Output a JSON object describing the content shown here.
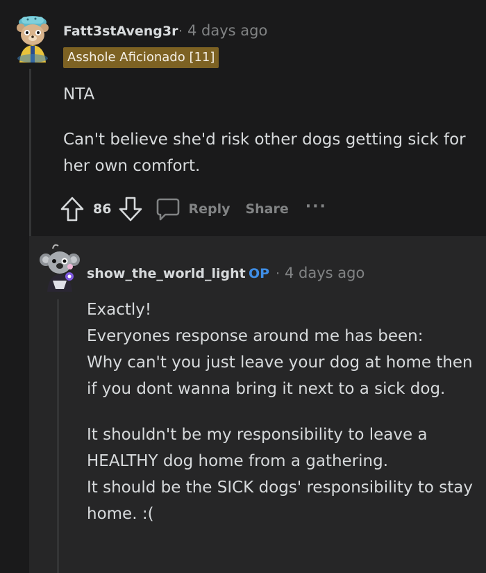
{
  "comment": {
    "username": "Fatt3stAveng3r",
    "separator": "·",
    "timestamp": "4 days ago",
    "flair": "Asshole Aficionado [11]",
    "body": [
      "NTA",
      "Can't believe she'd risk other dogs getting sick for her own comfort."
    ],
    "vote_count": "86",
    "reply_label": "Reply",
    "share_label": "Share",
    "more_label": "···",
    "icons": [
      "upvote-icon",
      "downvote-icon",
      "reply-icon",
      "more-icon"
    ]
  },
  "reply": {
    "username": "show_the_world_light",
    "op_badge": "OP",
    "separator": "·",
    "timestamp": "4 days ago",
    "body": {
      "line1": "Exactly!",
      "line2": "Everyones response around me has been:",
      "line3": "Why can't you just leave your dog at home then if you dont wanna bring it next to a sick dog.",
      "line4": "It shouldn't be my responsibility to leave a HEALTHY dog home from a gathering.",
      "line5": "It should be the SICK dogs' responsibility to stay home. :("
    }
  },
  "colors": {
    "background": "#1a1a1b",
    "reply_background": "#262627",
    "text": "#d7dadc",
    "muted": "#818384",
    "flair": "#7d6223",
    "op": "#3f8ee6"
  }
}
